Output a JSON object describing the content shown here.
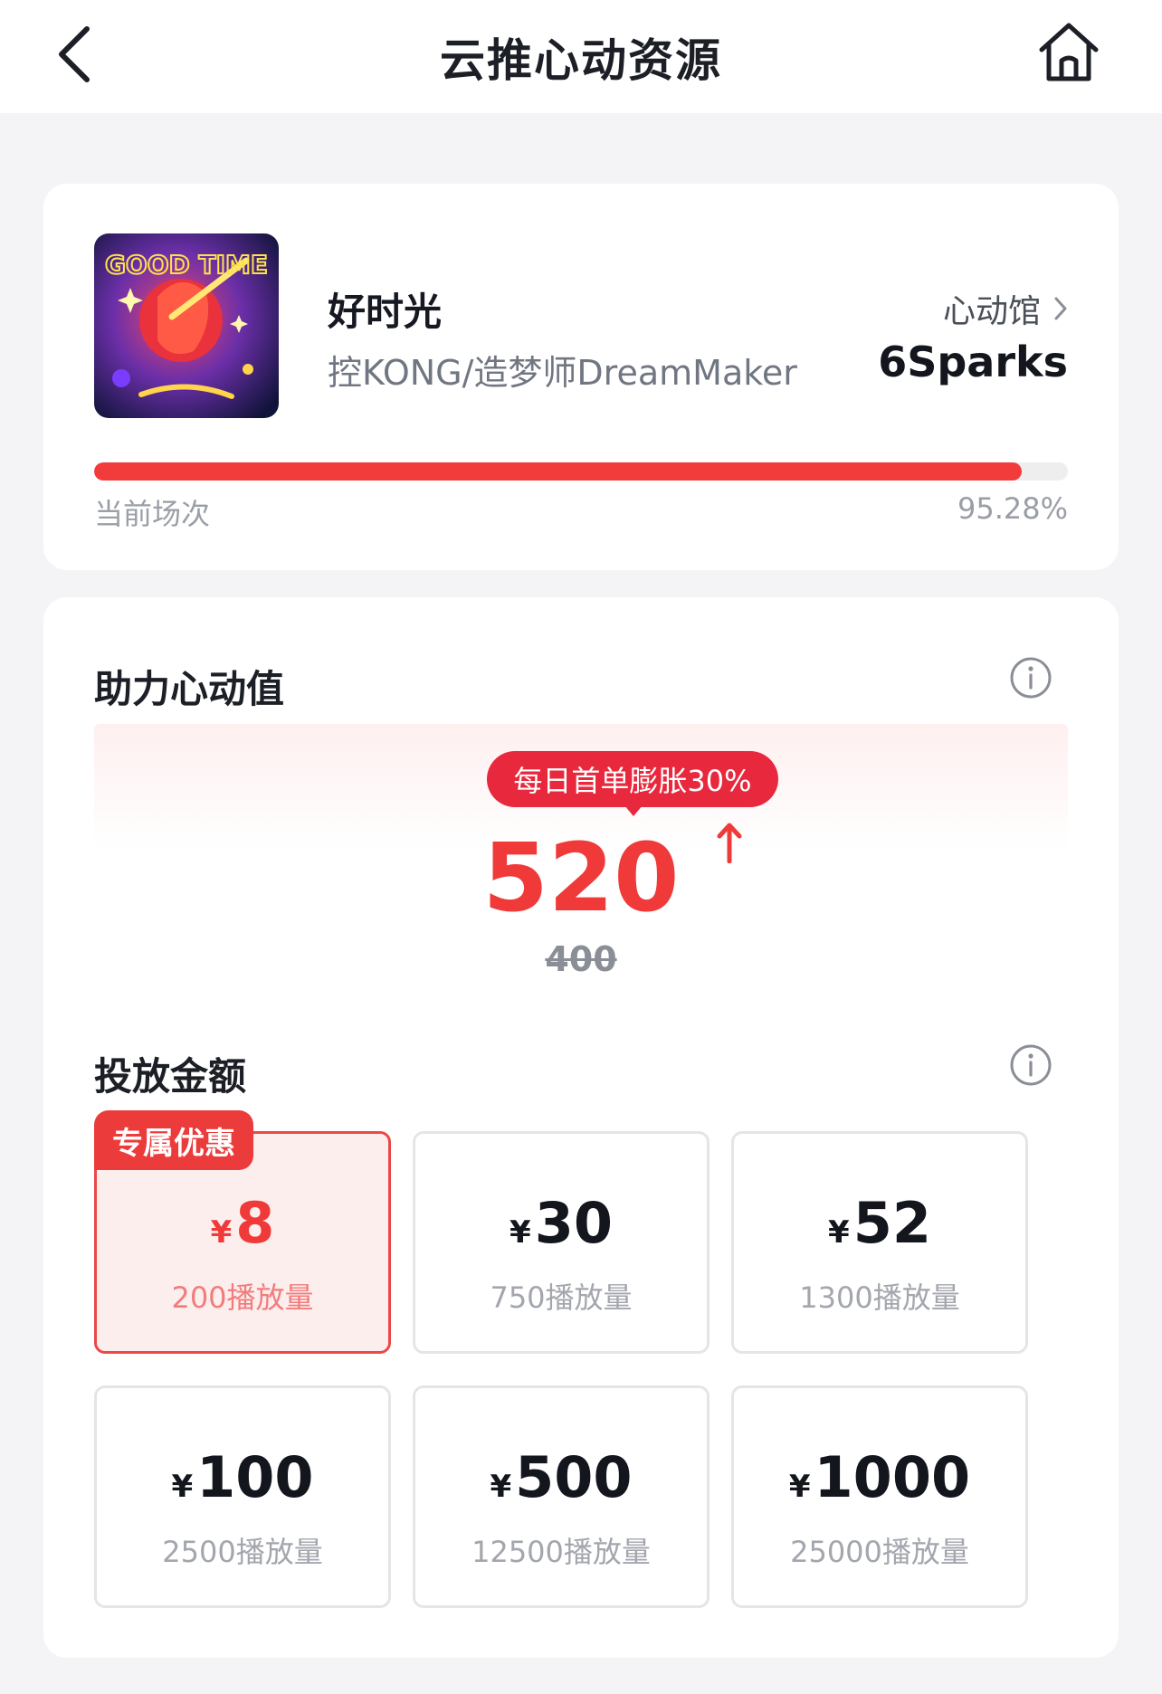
{
  "header": {
    "title": "云推心动资源",
    "back_icon": "chevron-left-icon",
    "home_icon": "home-icon"
  },
  "song": {
    "title": "好时光",
    "artist": "控KONG/造梦师DreamMaker",
    "venue_label": "心动馆",
    "venue_name": "6Sparks",
    "progress_label": "当前场次",
    "progress_text": "95.28%",
    "progress_value": 0.9528,
    "cover_text": "GOOD TIME"
  },
  "boost": {
    "title": "助力心动值",
    "promo": "每日首单膨胀30%",
    "value": "520",
    "old_value": "400"
  },
  "amounts": {
    "title": "投放金额",
    "currency": "¥",
    "badge": "专属优惠",
    "options": [
      {
        "price": "8",
        "plays": "200播放量",
        "selected": true
      },
      {
        "price": "30",
        "plays": "750播放量",
        "selected": false
      },
      {
        "price": "52",
        "plays": "1300播放量",
        "selected": false
      },
      {
        "price": "100",
        "plays": "2500播放量",
        "selected": false
      },
      {
        "price": "500",
        "plays": "12500播放量",
        "selected": false
      },
      {
        "price": "1000",
        "plays": "25000播放量",
        "selected": false
      }
    ]
  },
  "colors": {
    "accent": "#f03a3a",
    "badge": "#ec3b3b",
    "promo": "#e8283d"
  }
}
